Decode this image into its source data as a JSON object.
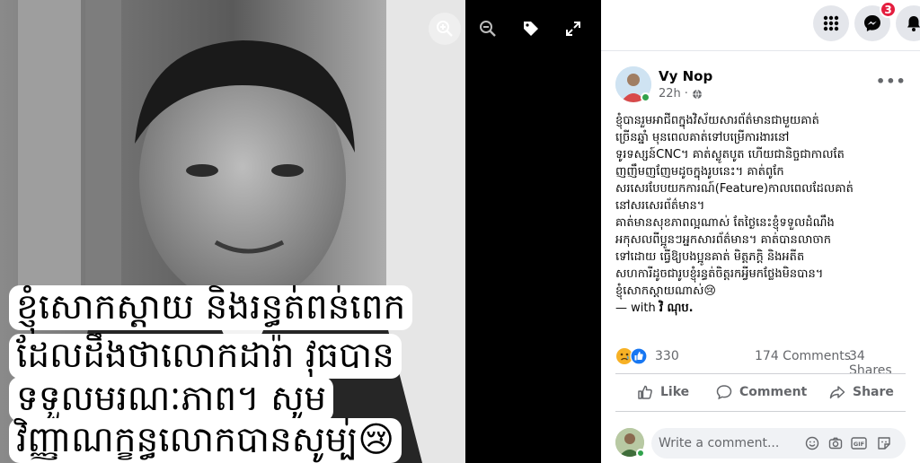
{
  "photo": {
    "caption_lines": [
      "ខ្ញុំសោកស្ដាយ និងរន្ធត់ពន់ពេក",
      "ដែលដឹងថាលោកដារ៉ា វុធបាន",
      "ទទួលមរណៈភាព។ សូម",
      "វិញ្ញាណក្ខន្ធលោកបានសូម្ប់😢"
    ]
  },
  "viewer_tools": {
    "zoom_in": "zoom-in-icon",
    "zoom_out": "zoom-out-icon",
    "tag": "tag-icon",
    "fullscreen": "fullscreen-icon"
  },
  "nav": {
    "messenger_badge": "3"
  },
  "post": {
    "author": "Vy Nop",
    "time": "22h",
    "privacy_icon": "globe-icon",
    "more": "•••",
    "text_lines": [
      "ខ្ញុំបានរួមអាជីពក្នុងវិស័យសារព័ត៌មានជាមួយគាត់",
      "ច្រើនឆ្នាំ មុនពេលគាត់ទៅបម្រើការងារនៅ",
      "ទូរទស្សន៍CNC។ គាត់ស្លូតបូត ហើយជានិច្ចជាកាលតែ",
      "ញញឹមញញែមដូចក្នុងរូបនេះ។ គាត់ពូកែ",
      "សរសេរបែបយកការណ៍(Feature)កាលពេលដែលគាត់",
      "នៅសរសេរព័ត៌មាន។",
      "គាត់មានសុខភាពល្អណាស់ តែថ្ងៃនេះខ្ញុំទទួលដំណឹង",
      "អកុសលពីប្អូនៗអ្នកសារព័ត៌មាន។ គាត់បានលាចាក",
      "ទៅដោយ ធ្វើឱ្យបងប្អូនគាត់ មិត្តភក្តិ និងអតីត",
      "សហការីដូចជារូបខ្ញុំរន្ធត់ចិត្តរកអ្វីមកថ្លែងមិនបាន។",
      "ខ្ញុំសោកស្ដាយណាស់😢"
    ],
    "with_prefix": "— with",
    "with_name": "វិ ណុប."
  },
  "stats": {
    "reactions": "330",
    "comments": "174 Comments",
    "shares": "34 Shares"
  },
  "actions": {
    "like": "Like",
    "comment": "Comment",
    "share": "Share"
  },
  "comment_box": {
    "placeholder": "Write a comment..."
  }
}
